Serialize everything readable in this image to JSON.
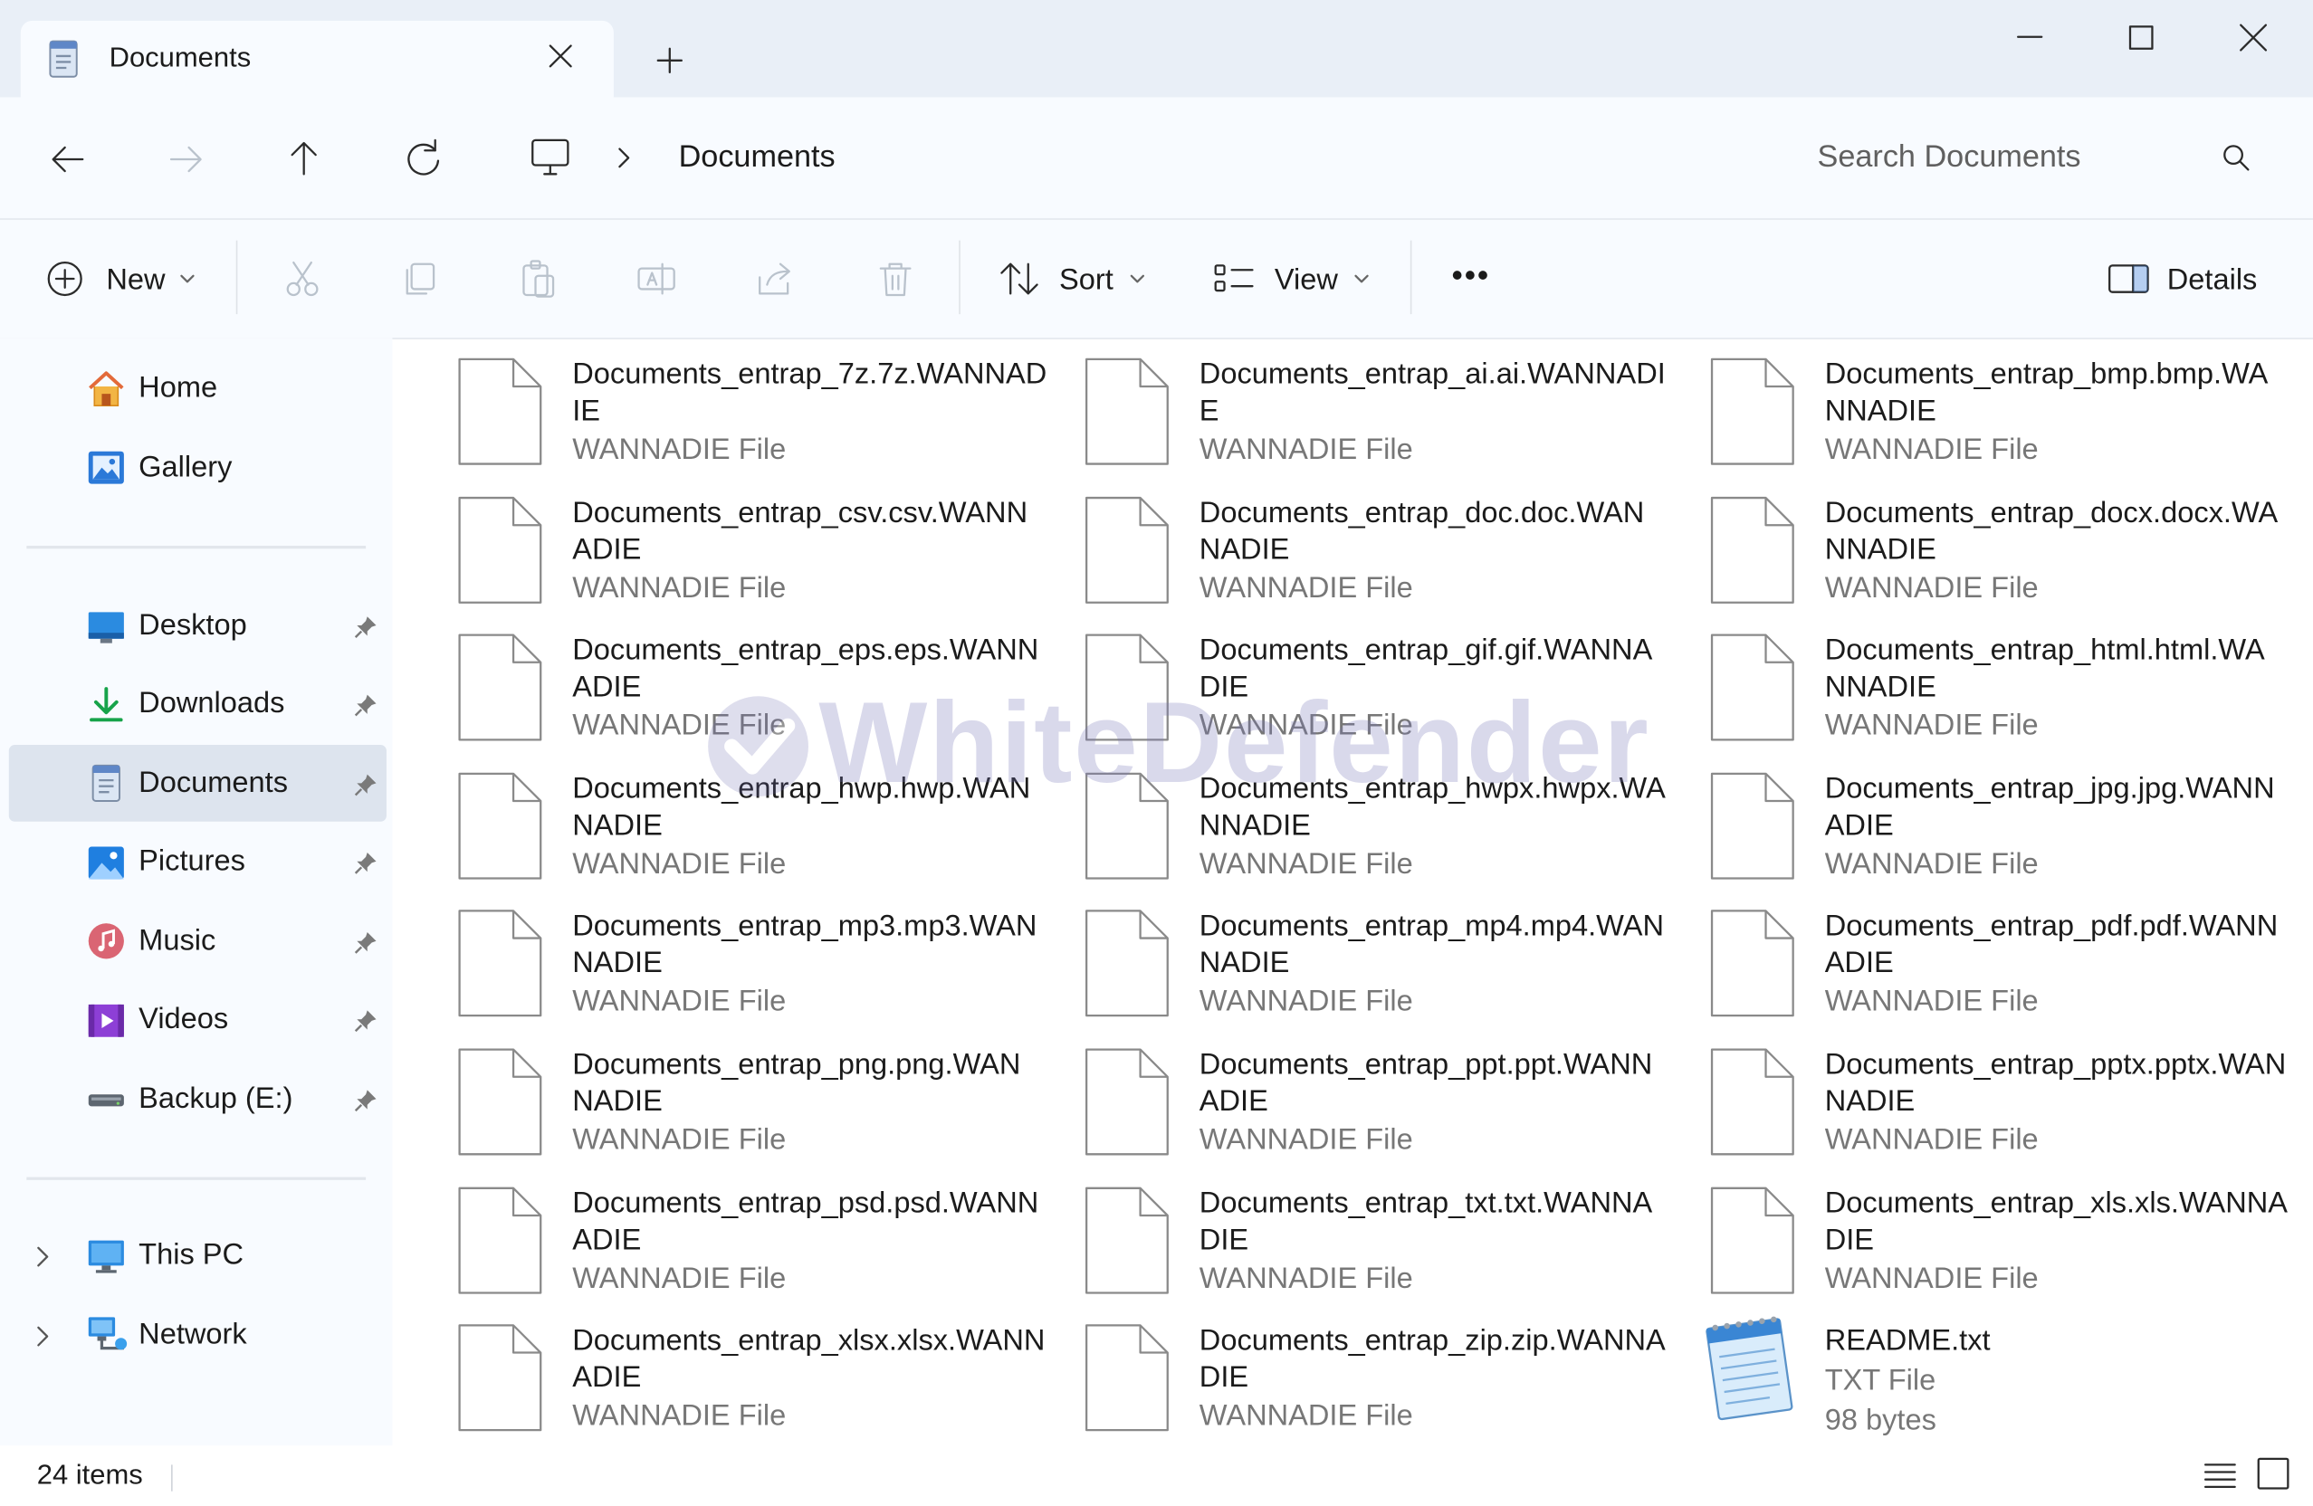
{
  "window": {
    "tab_title": "Documents",
    "controls": [
      "minimize",
      "maximize",
      "close"
    ]
  },
  "nav": {
    "breadcrumb_root_icon": "monitor-icon",
    "breadcrumb_current": "Documents",
    "search_placeholder": "Search Documents"
  },
  "toolbar": {
    "new_label": "New",
    "sort_label": "Sort",
    "view_label": "View",
    "more_label": "•••",
    "details_label": "Details"
  },
  "sidebar": {
    "top": [
      {
        "label": "Home",
        "icon": "home-icon"
      },
      {
        "label": "Gallery",
        "icon": "gallery-icon"
      }
    ],
    "quick_access": [
      {
        "label": "Desktop",
        "icon": "desktop-icon",
        "pinned": true
      },
      {
        "label": "Downloads",
        "icon": "downloads-icon",
        "pinned": true
      },
      {
        "label": "Documents",
        "icon": "documents-icon",
        "pinned": true,
        "selected": true
      },
      {
        "label": "Pictures",
        "icon": "pictures-icon",
        "pinned": true
      },
      {
        "label": "Music",
        "icon": "music-icon",
        "pinned": true
      },
      {
        "label": "Videos",
        "icon": "videos-icon",
        "pinned": true
      },
      {
        "label": "Backup (E:)",
        "icon": "drive-icon",
        "pinned": true
      }
    ],
    "locations": [
      {
        "label": "This PC",
        "icon": "this-pc-icon"
      },
      {
        "label": "Network",
        "icon": "network-icon"
      }
    ]
  },
  "files": [
    {
      "name_l1": "Documents_entrap_7z.7z.WANNAD",
      "name_l2": "IE",
      "type": "WANNADIE File"
    },
    {
      "name_l1": "Documents_entrap_ai.ai.WANNADI",
      "name_l2": "E",
      "type": "WANNADIE File"
    },
    {
      "name_l1": "Documents_entrap_bmp.bmp.WA",
      "name_l2": "NNADIE",
      "type": "WANNADIE File"
    },
    {
      "name_l1": "Documents_entrap_csv.csv.WANN",
      "name_l2": "ADIE",
      "type": "WANNADIE File"
    },
    {
      "name_l1": "Documents_entrap_doc.doc.WAN",
      "name_l2": "NADIE",
      "type": "WANNADIE File"
    },
    {
      "name_l1": "Documents_entrap_docx.docx.WA",
      "name_l2": "NNADIE",
      "type": "WANNADIE File"
    },
    {
      "name_l1": "Documents_entrap_eps.eps.WANN",
      "name_l2": "ADIE",
      "type": "WANNADIE File"
    },
    {
      "name_l1": "Documents_entrap_gif.gif.WANNA",
      "name_l2": "DIE",
      "type": "WANNADIE File"
    },
    {
      "name_l1": "Documents_entrap_html.html.WA",
      "name_l2": "NNADIE",
      "type": "WANNADIE File"
    },
    {
      "name_l1": "Documents_entrap_hwp.hwp.WAN",
      "name_l2": "NADIE",
      "type": "WANNADIE File"
    },
    {
      "name_l1": "Documents_entrap_hwpx.hwpx.WA",
      "name_l2": "NNADIE",
      "type": "WANNADIE File"
    },
    {
      "name_l1": "Documents_entrap_jpg.jpg.WANN",
      "name_l2": "ADIE",
      "type": "WANNADIE File"
    },
    {
      "name_l1": "Documents_entrap_mp3.mp3.WAN",
      "name_l2": "NADIE",
      "type": "WANNADIE File"
    },
    {
      "name_l1": "Documents_entrap_mp4.mp4.WAN",
      "name_l2": "NADIE",
      "type": "WANNADIE File"
    },
    {
      "name_l1": "Documents_entrap_pdf.pdf.WANN",
      "name_l2": "ADIE",
      "type": "WANNADIE File"
    },
    {
      "name_l1": "Documents_entrap_png.png.WAN",
      "name_l2": "NADIE",
      "type": "WANNADIE File"
    },
    {
      "name_l1": "Documents_entrap_ppt.ppt.WANN",
      "name_l2": "ADIE",
      "type": "WANNADIE File"
    },
    {
      "name_l1": "Documents_entrap_pptx.pptx.WAN",
      "name_l2": "NADIE",
      "type": "WANNADIE File"
    },
    {
      "name_l1": "Documents_entrap_psd.psd.WANN",
      "name_l2": "ADIE",
      "type": "WANNADIE File"
    },
    {
      "name_l1": "Documents_entrap_txt.txt.WANNA",
      "name_l2": "DIE",
      "type": "WANNADIE File"
    },
    {
      "name_l1": "Documents_entrap_xls.xls.WANNA",
      "name_l2": "DIE",
      "type": "WANNADIE File"
    },
    {
      "name_l1": "Documents_entrap_xlsx.xlsx.WANN",
      "name_l2": "ADIE",
      "type": "WANNADIE File"
    },
    {
      "name_l1": "Documents_entrap_zip.zip.WANNA",
      "name_l2": "DIE",
      "type": "WANNADIE File"
    },
    {
      "name_l1": "README.txt",
      "name_l2": "",
      "type": "TXT File",
      "size": "98 bytes",
      "icon": "notepad-icon"
    }
  ],
  "status": {
    "item_count": "24 items"
  },
  "watermark": {
    "text": "WhiteDefender"
  }
}
